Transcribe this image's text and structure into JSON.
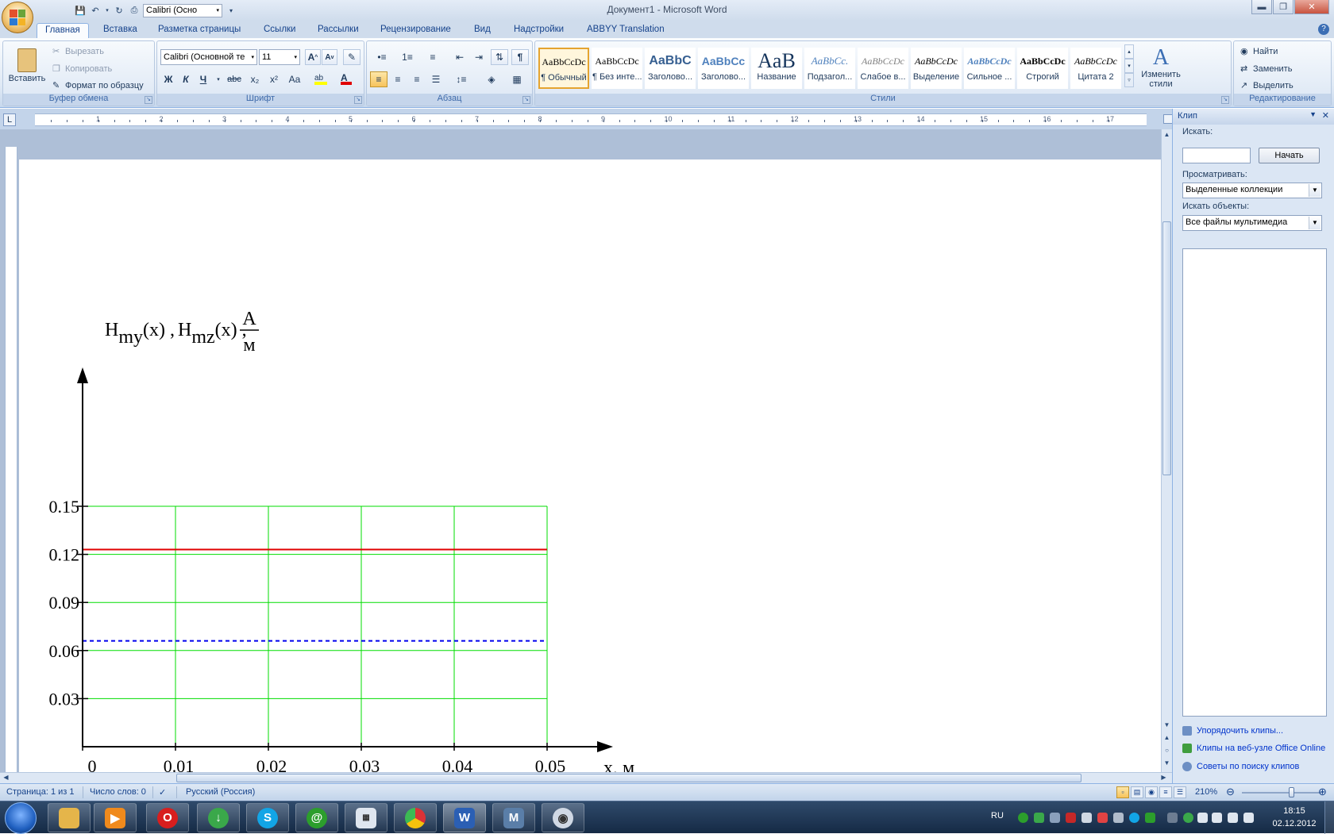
{
  "window": {
    "title": "Документ1 - Microsoft Word"
  },
  "quick_access": {
    "font_value": "Calibri (Осно"
  },
  "tabs": [
    {
      "label": "Главная",
      "active": true
    },
    {
      "label": "Вставка"
    },
    {
      "label": "Разметка страницы"
    },
    {
      "label": "Ссылки"
    },
    {
      "label": "Рассылки"
    },
    {
      "label": "Рецензирование"
    },
    {
      "label": "Вид"
    },
    {
      "label": "Надстройки"
    },
    {
      "label": "ABBYY Translation"
    }
  ],
  "ribbon": {
    "clipboard": {
      "label": "Буфер обмена",
      "paste": "Вставить",
      "cut": "Вырезать",
      "copy": "Копировать",
      "format_painter": "Формат по образцу"
    },
    "font": {
      "label": "Шрифт",
      "font_name": "Calibri (Основной те",
      "font_size": "11",
      "bold": "Ж",
      "italic": "К",
      "underline": "Ч",
      "strike": "abc",
      "subscript": "x₂",
      "superscript": "x²",
      "case": "Aa"
    },
    "paragraph": {
      "label": "Абзац"
    },
    "styles": {
      "label": "Стили",
      "change_styles": "Изменить стили",
      "items": [
        {
          "sample": "AaBbCcDc",
          "name": "¶ Обычный",
          "selected": true
        },
        {
          "sample": "AaBbCcDc",
          "name": "¶ Без инте..."
        },
        {
          "sample": "AaBbC",
          "name": "Заголово..."
        },
        {
          "sample": "AaBbCc",
          "name": "Заголово..."
        },
        {
          "sample": "AaB",
          "name": "Название"
        },
        {
          "sample": "AaBbCc.",
          "name": "Подзагол..."
        },
        {
          "sample": "AaBbCcDc",
          "name": "Слабое в..."
        },
        {
          "sample": "AaBbCcDc",
          "name": "Выделение"
        },
        {
          "sample": "AaBbCcDc",
          "name": "Сильное ..."
        },
        {
          "sample": "AaBbCcDc",
          "name": "Строгий"
        },
        {
          "sample": "AaBbCcDc",
          "name": "Цитата 2"
        }
      ]
    },
    "editing": {
      "label": "Редактирование",
      "find": "Найти",
      "replace": "Заменить",
      "select": "Выделить"
    }
  },
  "ruler": {
    "numbers": [
      "1",
      "2",
      "3",
      "4",
      "5",
      "6",
      "7",
      "8",
      "9",
      "10",
      "11",
      "12",
      "13",
      "14",
      "15",
      "16",
      "17"
    ]
  },
  "task_pane": {
    "title": "Клип",
    "search_label": "Искать:",
    "search_value": "",
    "go_button": "Начать",
    "browse_label": "Просматривать:",
    "browse_value": "Выделенные коллекции",
    "objects_label": "Искать объекты:",
    "objects_value": "Все файлы мультимедиа",
    "links": [
      "Упорядочить клипы...",
      "Клипы на веб-узле Office Online",
      "Советы по поиску клипов"
    ]
  },
  "status": {
    "page": "Страница: 1 из 1",
    "words": "Число слов: 0",
    "language": "Русский (Россия)",
    "zoom": "210%",
    "zoom_fraction": 0.62
  },
  "taskbar": {
    "lang": "RU",
    "time": "18:15",
    "date": "02.12.2012"
  },
  "colors": {
    "grid": "#00dd00",
    "series_red": "#e00000",
    "series_blue": "#0000ee"
  },
  "chart_data": {
    "type": "line",
    "y_label_text": {
      "main1": "H",
      "sub1": "my",
      "arg1": "(x) ,",
      "main2": "H",
      "sub2": "mz",
      "arg2": "(x) ,",
      "num": "A",
      "den": "м"
    },
    "xlabel": "x, м",
    "xlim": [
      0,
      0.05
    ],
    "ylim": [
      0,
      0.15
    ],
    "x_ticks": [
      "0",
      "0.01",
      "0.02",
      "0.03",
      "0.04",
      "0.05"
    ],
    "x_tick_values": [
      0,
      0.01,
      0.02,
      0.03,
      0.04,
      0.05
    ],
    "y_ticks": [
      "0.15",
      "0.12",
      "0.09",
      "0.06",
      "0.03"
    ],
    "y_tick_values": [
      0.15,
      0.12,
      0.09,
      0.06,
      0.03
    ],
    "series": [
      {
        "x": [
          0,
          0.05
        ],
        "values": [
          0.123,
          0.123
        ],
        "color": "#e00000",
        "style": "solid"
      },
      {
        "x": [
          0,
          0.05
        ],
        "values": [
          0.066,
          0.066
        ],
        "color": "#0000ee",
        "style": "dashed"
      }
    ]
  }
}
